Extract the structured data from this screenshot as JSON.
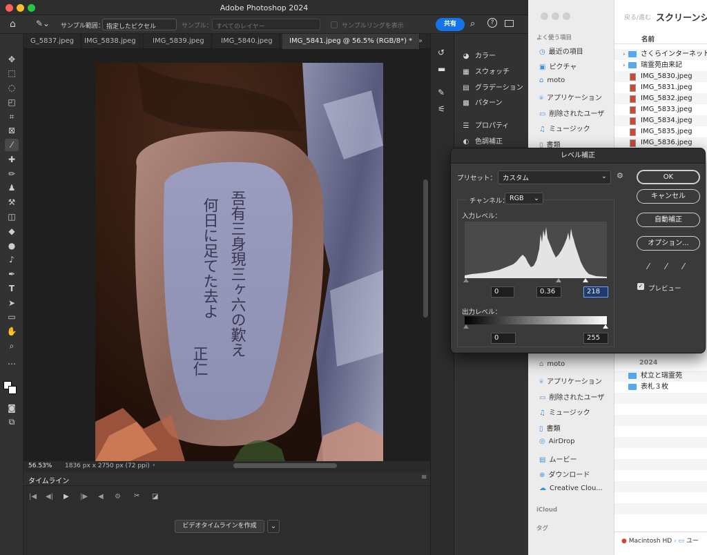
{
  "app": {
    "title": "Adobe Photoshop 2024"
  },
  "options": {
    "sample_range_label": "サンプル範囲：",
    "sample_range_value": "指定したピクセル",
    "sample_label": "サンプル：",
    "sample_value": "すべてのレイヤー",
    "sampling_ring": "サンプルリングを表示",
    "share": "共有"
  },
  "tabs": [
    {
      "label": "G_5837.jpeg"
    },
    {
      "label": "IMG_5838.jpeg"
    },
    {
      "label": "IMG_5839.jpeg"
    },
    {
      "label": "IMG_5840.jpeg"
    },
    {
      "label": "IMG_5841.jpeg @ 56.5% (RGB/8*) *"
    }
  ],
  "status": {
    "zoom": "56.53%",
    "doc_info": "1836 px x 2750 px (72 ppi)"
  },
  "timeline": {
    "title": "タイムライン",
    "create_button": "ビデオタイムラインを作成"
  },
  "panels": [
    {
      "label": "カラー",
      "icon": "palette-icon"
    },
    {
      "label": "スウォッチ",
      "icon": "grid-icon"
    },
    {
      "label": "グラデーション",
      "icon": "gradient-icon"
    },
    {
      "label": "パターン",
      "icon": "pattern-icon"
    },
    {
      "label": "プロパティ",
      "icon": "sliders-icon"
    },
    {
      "label": "色調補正",
      "icon": "adjust-icon"
    }
  ],
  "levels": {
    "title": "レベル補正",
    "preset_label": "プリセット：",
    "preset_value": "カスタム",
    "channel_label": "チャンネル：",
    "channel_value": "RGB",
    "input_label": "入力レベル：",
    "input_black": "0",
    "input_gamma": "0.36",
    "input_white": "218",
    "output_label": "出力レベル：",
    "output_black": "0",
    "output_white": "255",
    "ok": "OK",
    "cancel": "キャンセル",
    "auto": "自動補正",
    "options": "オプション...",
    "preview": "プレビュー"
  },
  "finder": {
    "nav": "戻る/進む",
    "title": "スクリーンショ",
    "name_col": "名前",
    "fav_header": "よく使う項目",
    "sidebar_top": [
      "最近の項目",
      "ピクチャ",
      "moto",
      "アプリケーション",
      "削除されたユーザ",
      "ミュージック",
      "書類"
    ],
    "sidebar_bottom": [
      "moto",
      "アプリケーション",
      "削除されたユーザ",
      "ミュージック",
      "書類",
      "AirDrop",
      "ムービー",
      "ダウンロード",
      "Creative Clou..."
    ],
    "icloud": "iCloud",
    "tags": "タグ",
    "files": [
      "さくらインターネット調",
      "瑞霊苑由来記",
      "IMG_5830.jpeg",
      "IMG_5831.jpeg",
      "IMG_5832.jpeg",
      "IMG_5833.jpeg",
      "IMG_5834.jpeg",
      "IMG_5835.jpeg",
      "IMG_5836.jpeg"
    ],
    "year": "2024",
    "folders2": [
      "杖立と瑞霊苑",
      "表札３枚"
    ],
    "path_disk": "Macintosh HD",
    "path_sep": "ユー"
  },
  "photo": {
    "inscription_1": "吾有三身現三ヶ六の歎え",
    "inscription_2": "何日に足てた去よ",
    "signature": "正仁"
  }
}
